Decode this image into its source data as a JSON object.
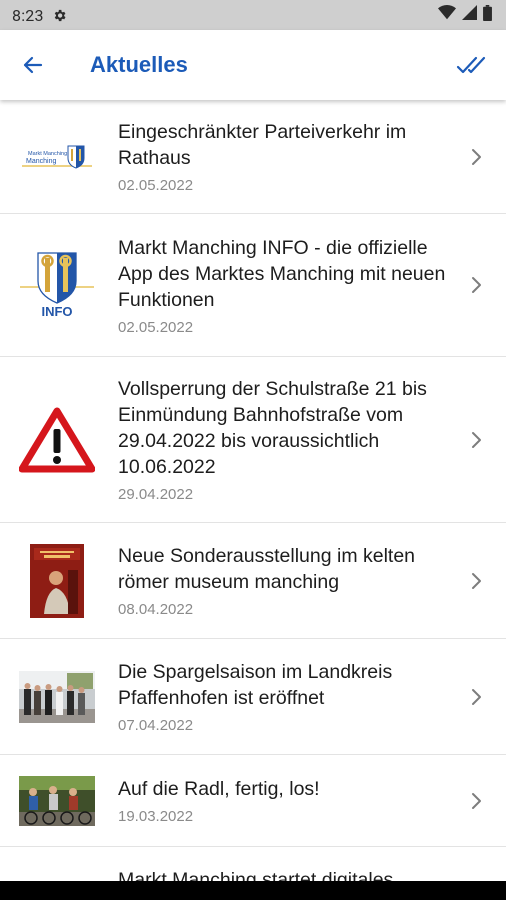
{
  "status": {
    "time": "8:23"
  },
  "appbar": {
    "title": "Aktuelles"
  },
  "news": [
    {
      "title": "Eingeschränkter Parteiverkehr im Rathaus",
      "date": "02.05.2022",
      "thumb": "markt-manching-logo",
      "thumb_text": "Markt Manching"
    },
    {
      "title": "Markt Manching INFO - die offizielle App des Marktes Manching mit neuen Funktionen",
      "date": "02.05.2022",
      "thumb": "coat-of-arms-info-logo",
      "thumb_text": "INFO"
    },
    {
      "title": "Vollsperrung der Schulstraße 21 bis Einmündung Bahnhofstraße vom 29.04.2022 bis voraussichtlich 10.06.2022",
      "date": "29.04.2022",
      "thumb": "warning-sign-icon"
    },
    {
      "title": "Neue Sonderausstellung im kelten römer museum manching",
      "date": "08.04.2022",
      "thumb": "exhibition-poster-photo"
    },
    {
      "title": "Die Spargelsaison im Landkreis Pfaffenhofen ist eröffnet",
      "date": "07.04.2022",
      "thumb": "group-photo"
    },
    {
      "title": "Auf die Radl, fertig, los!",
      "date": "19.03.2022",
      "thumb": "cyclists-photo"
    },
    {
      "title": "Markt Manching startet digitales",
      "date": ""
    }
  ],
  "colors": {
    "accent": "#1c5bb8",
    "status_bar": "#cfcfcf",
    "divider": "#e3e3e3",
    "date_text": "#8a8a8a"
  }
}
